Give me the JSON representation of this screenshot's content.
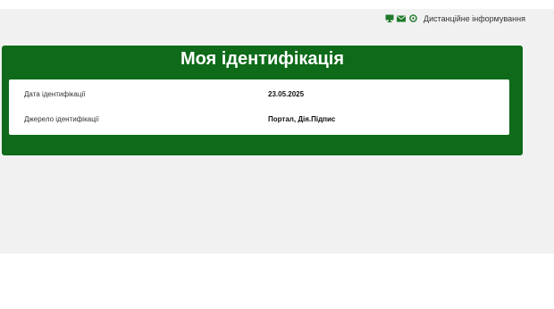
{
  "topbar": {
    "icons": [
      "monitor-icon",
      "mail-icon",
      "settings-icon"
    ],
    "link_label": "Дистанційне інформування"
  },
  "identification": {
    "title": "Моя ідентифікація",
    "rows": [
      {
        "label": "Дата ідентифікації",
        "value": "23.05.2025"
      },
      {
        "label": "Джерело ідентифікації",
        "value": "Портал, Дія.Підпис"
      }
    ]
  },
  "colors": {
    "panel_green": "#0f6a1a",
    "icon_green": "#1f7a2a"
  }
}
